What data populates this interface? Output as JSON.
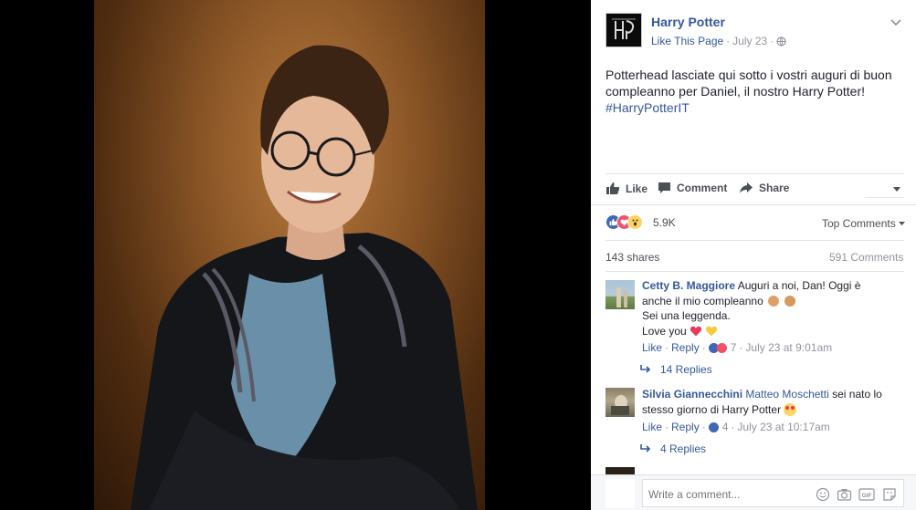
{
  "post": {
    "page_name": "Harry Potter",
    "like_page": "Like This Page",
    "date": "July 23",
    "text_line1": "Potterhead lasciate qui sotto i vostri auguri di buon",
    "text_line2": "compleanno per Daniel, il nostro Harry Potter!",
    "hashtag": "#HarryPotterIT"
  },
  "actions": {
    "like": "Like",
    "comment": "Comment",
    "share": "Share"
  },
  "stats": {
    "reactions": "5.9K",
    "sort": "Top Comments",
    "shares": "143 shares",
    "comments": "591 Comments"
  },
  "comments": [
    {
      "author": "Cetty B. Maggiore",
      "line1": "Auguri a noi, Dan! Oggi è",
      "line2": "anche il mio compleanno",
      "line3": "Sei una leggenda.",
      "line4": "Love you",
      "like": "Like",
      "reply": "Reply",
      "count": "7",
      "date": "July 23 at 9:01am",
      "replies": "14 Replies"
    },
    {
      "author": "Silvia Giannecchini",
      "mention": "Matteo Moschetti",
      "line1": "sei nato lo",
      "line2": "stesso giorno di Harry Potter",
      "like": "Like",
      "reply": "Reply",
      "count": "4",
      "date": "July 23 at 10:17am",
      "replies": "4 Replies"
    }
  ],
  "composer": {
    "placeholder": "Write a comment..."
  },
  "colors": {
    "link": "#365899",
    "muted": "#90949c",
    "text": "#1d2129",
    "like_blue": "#4267b2",
    "love_red": "#f25268",
    "wow_yellow": "#fdd462"
  }
}
